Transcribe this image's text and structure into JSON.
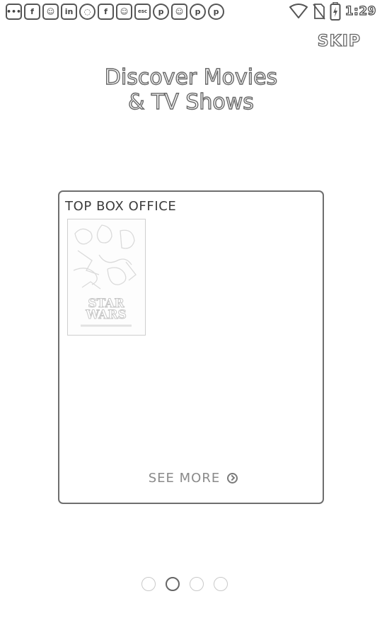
{
  "status_bar": {
    "notification_icons": [
      {
        "name": "messenger-icon",
        "glyph": "•••",
        "round": false,
        "tiny": false
      },
      {
        "name": "facebook-icon",
        "glyph": "f",
        "round": false,
        "tiny": false
      },
      {
        "name": "reddit-icon",
        "glyph": "☺",
        "round": false,
        "tiny": false
      },
      {
        "name": "linkedin-icon",
        "glyph": "in",
        "round": false,
        "tiny": false
      },
      {
        "name": "whatsapp-icon",
        "glyph": "◌",
        "round": true,
        "tiny": false
      },
      {
        "name": "facebook-icon",
        "glyph": "f",
        "round": false,
        "tiny": false
      },
      {
        "name": "reddit-icon",
        "glyph": "☺",
        "round": false,
        "tiny": false
      },
      {
        "name": "esc-app-icon",
        "glyph": "esc",
        "round": false,
        "tiny": true
      },
      {
        "name": "pinterest-icon",
        "glyph": "p",
        "round": true,
        "tiny": false
      },
      {
        "name": "reddit-icon",
        "glyph": "☺",
        "round": false,
        "tiny": false
      },
      {
        "name": "pinterest-icon",
        "glyph": "p",
        "round": true,
        "tiny": false
      },
      {
        "name": "pinterest-icon",
        "glyph": "p",
        "round": true,
        "tiny": false
      }
    ],
    "time": "1:29",
    "system_icons": [
      "wifi-icon",
      "no-sim-icon",
      "battery-charging-icon"
    ]
  },
  "skip_label": "SKIP",
  "headline": {
    "line1": "Discover Movies",
    "line2": "& TV Shows"
  },
  "card": {
    "title": "TOP BOX OFFICE",
    "poster_name": "star-wars-poster",
    "see_more_label": "SEE MORE"
  },
  "pager": {
    "count": 4,
    "active_index": 1
  }
}
